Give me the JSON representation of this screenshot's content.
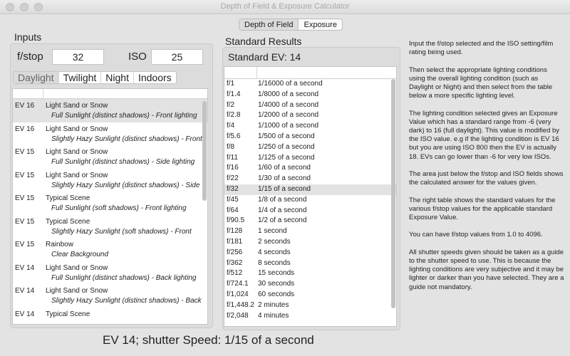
{
  "window": {
    "title": "Depth of Field & Exposure Calculator"
  },
  "tabs": {
    "dof": "Depth of Field",
    "exposure": "Exposure"
  },
  "inputs": {
    "title": "Inputs",
    "fstop_label": "f/stop",
    "fstop_value": "32",
    "iso_label": "ISO",
    "iso_value": "25",
    "conditions": [
      "Daylight",
      "Twilight",
      "Night",
      "Indoors"
    ],
    "selected_condition": "Daylight"
  },
  "lighting_list": [
    {
      "ev": "EV 16",
      "scene": "Light Sand or Snow",
      "condition": "Full Sunlight (distinct shadows) - Front lighting"
    },
    {
      "ev": "EV 16",
      "scene": "Light Sand or Snow",
      "condition": "Slightly Hazy Sunlight (distinct shadows) - Front"
    },
    {
      "ev": "EV 15",
      "scene": "Light Sand or Snow",
      "condition": "Full Sunlight (distinct shadows) - Side lighting"
    },
    {
      "ev": "EV 15",
      "scene": "Light Sand or Snow",
      "condition": "Slightly Hazy Sunlight (distinct shadows) - Side"
    },
    {
      "ev": "EV 15",
      "scene": "Typical Scene",
      "condition": "Full Sunlight (soft shadows) - Front lighting"
    },
    {
      "ev": "EV 15",
      "scene": "Typical Scene",
      "condition": "Slightly Hazy Sunlight (soft shadows) - Front"
    },
    {
      "ev": "EV 15",
      "scene": "Rainbow",
      "condition": "Clear Background"
    },
    {
      "ev": "EV 14",
      "scene": "Light Sand or Snow",
      "condition": "Full Sunlight (distinct shadows) - Back lighting"
    },
    {
      "ev": "EV 14",
      "scene": "Light Sand or Snow",
      "condition": "Slightly Hazy Sunlight (distinct shadows) - Back"
    },
    {
      "ev": "EV 14",
      "scene": "Typical Scene",
      "condition": ""
    }
  ],
  "standard_results": {
    "title": "Standard Results",
    "ev_label": "Standard EV: 14",
    "rows": [
      {
        "f": "f/1",
        "speed": "1/16000 of a second"
      },
      {
        "f": "f/1.4",
        "speed": "1/8000 of a second"
      },
      {
        "f": "f/2",
        "speed": "1/4000 of a second"
      },
      {
        "f": "f/2.8",
        "speed": "1/2000 of a second"
      },
      {
        "f": "f/4",
        "speed": "1/1000 of a second"
      },
      {
        "f": "f/5.6",
        "speed": "1/500 of a second"
      },
      {
        "f": "f/8",
        "speed": "1/250 of a second"
      },
      {
        "f": "f/11",
        "speed": "1/125 of a second"
      },
      {
        "f": "f/16",
        "speed": "1/60 of a second"
      },
      {
        "f": "f/22",
        "speed": "1/30 of a second"
      },
      {
        "f": "f/32",
        "speed": "1/15 of a second"
      },
      {
        "f": "f/45",
        "speed": "1/8 of a second"
      },
      {
        "f": "f/64",
        "speed": "1/4 of a second"
      },
      {
        "f": "f/90.5",
        "speed": "1/2 of a second"
      },
      {
        "f": "f/128",
        "speed": "1 second"
      },
      {
        "f": "f/181",
        "speed": "2 seconds"
      },
      {
        "f": "f/256",
        "speed": "4 seconds"
      },
      {
        "f": "f/362",
        "speed": "8 seconds"
      },
      {
        "f": "f/512",
        "speed": "15 seconds"
      },
      {
        "f": "f/724.1",
        "speed": "30 seconds"
      },
      {
        "f": "f/1,024",
        "speed": "60 seconds"
      },
      {
        "f": "f/1,448.2",
        "speed": "2 minutes"
      },
      {
        "f": "f/2,048",
        "speed": "4 minutes"
      },
      {
        "f": "",
        "speed": ""
      }
    ]
  },
  "help_text": [
    "Input the f/stop selected and the ISO setting/film rating being used.",
    "Then select the appropriate lighting conditions using the overall lighting condition (such as Daylight or Night) and then select from the table below a more specific lighting level.",
    "The lighting condition selected gives an Exposure Value which has a standard range from -6 (very dark) to 16 (full daylight).  This value is modified by the ISO value.  e.g if the lighting condition is EV 16 but you are using ISO 800 then the EV is actually 18.  EVs can go lower than -6 for very low ISOs.",
    "The area just below the f/stop and ISO fields shows the calculated answer for the values given.",
    "The right table shows the standard values for the various f/stop values for the applicable standard Exposure Value.",
    "You can have f/stop values from 1.0 to 4096.",
    "All shutter speeds given should be taken as a guide to the shutter speed to use.  This is because the lighting conditions are very subjective and it may be lighter or darker than you have selected.  They are a guide not mandatory."
  ],
  "result_line": "EV 14; shutter Speed: 1/15 of a second"
}
